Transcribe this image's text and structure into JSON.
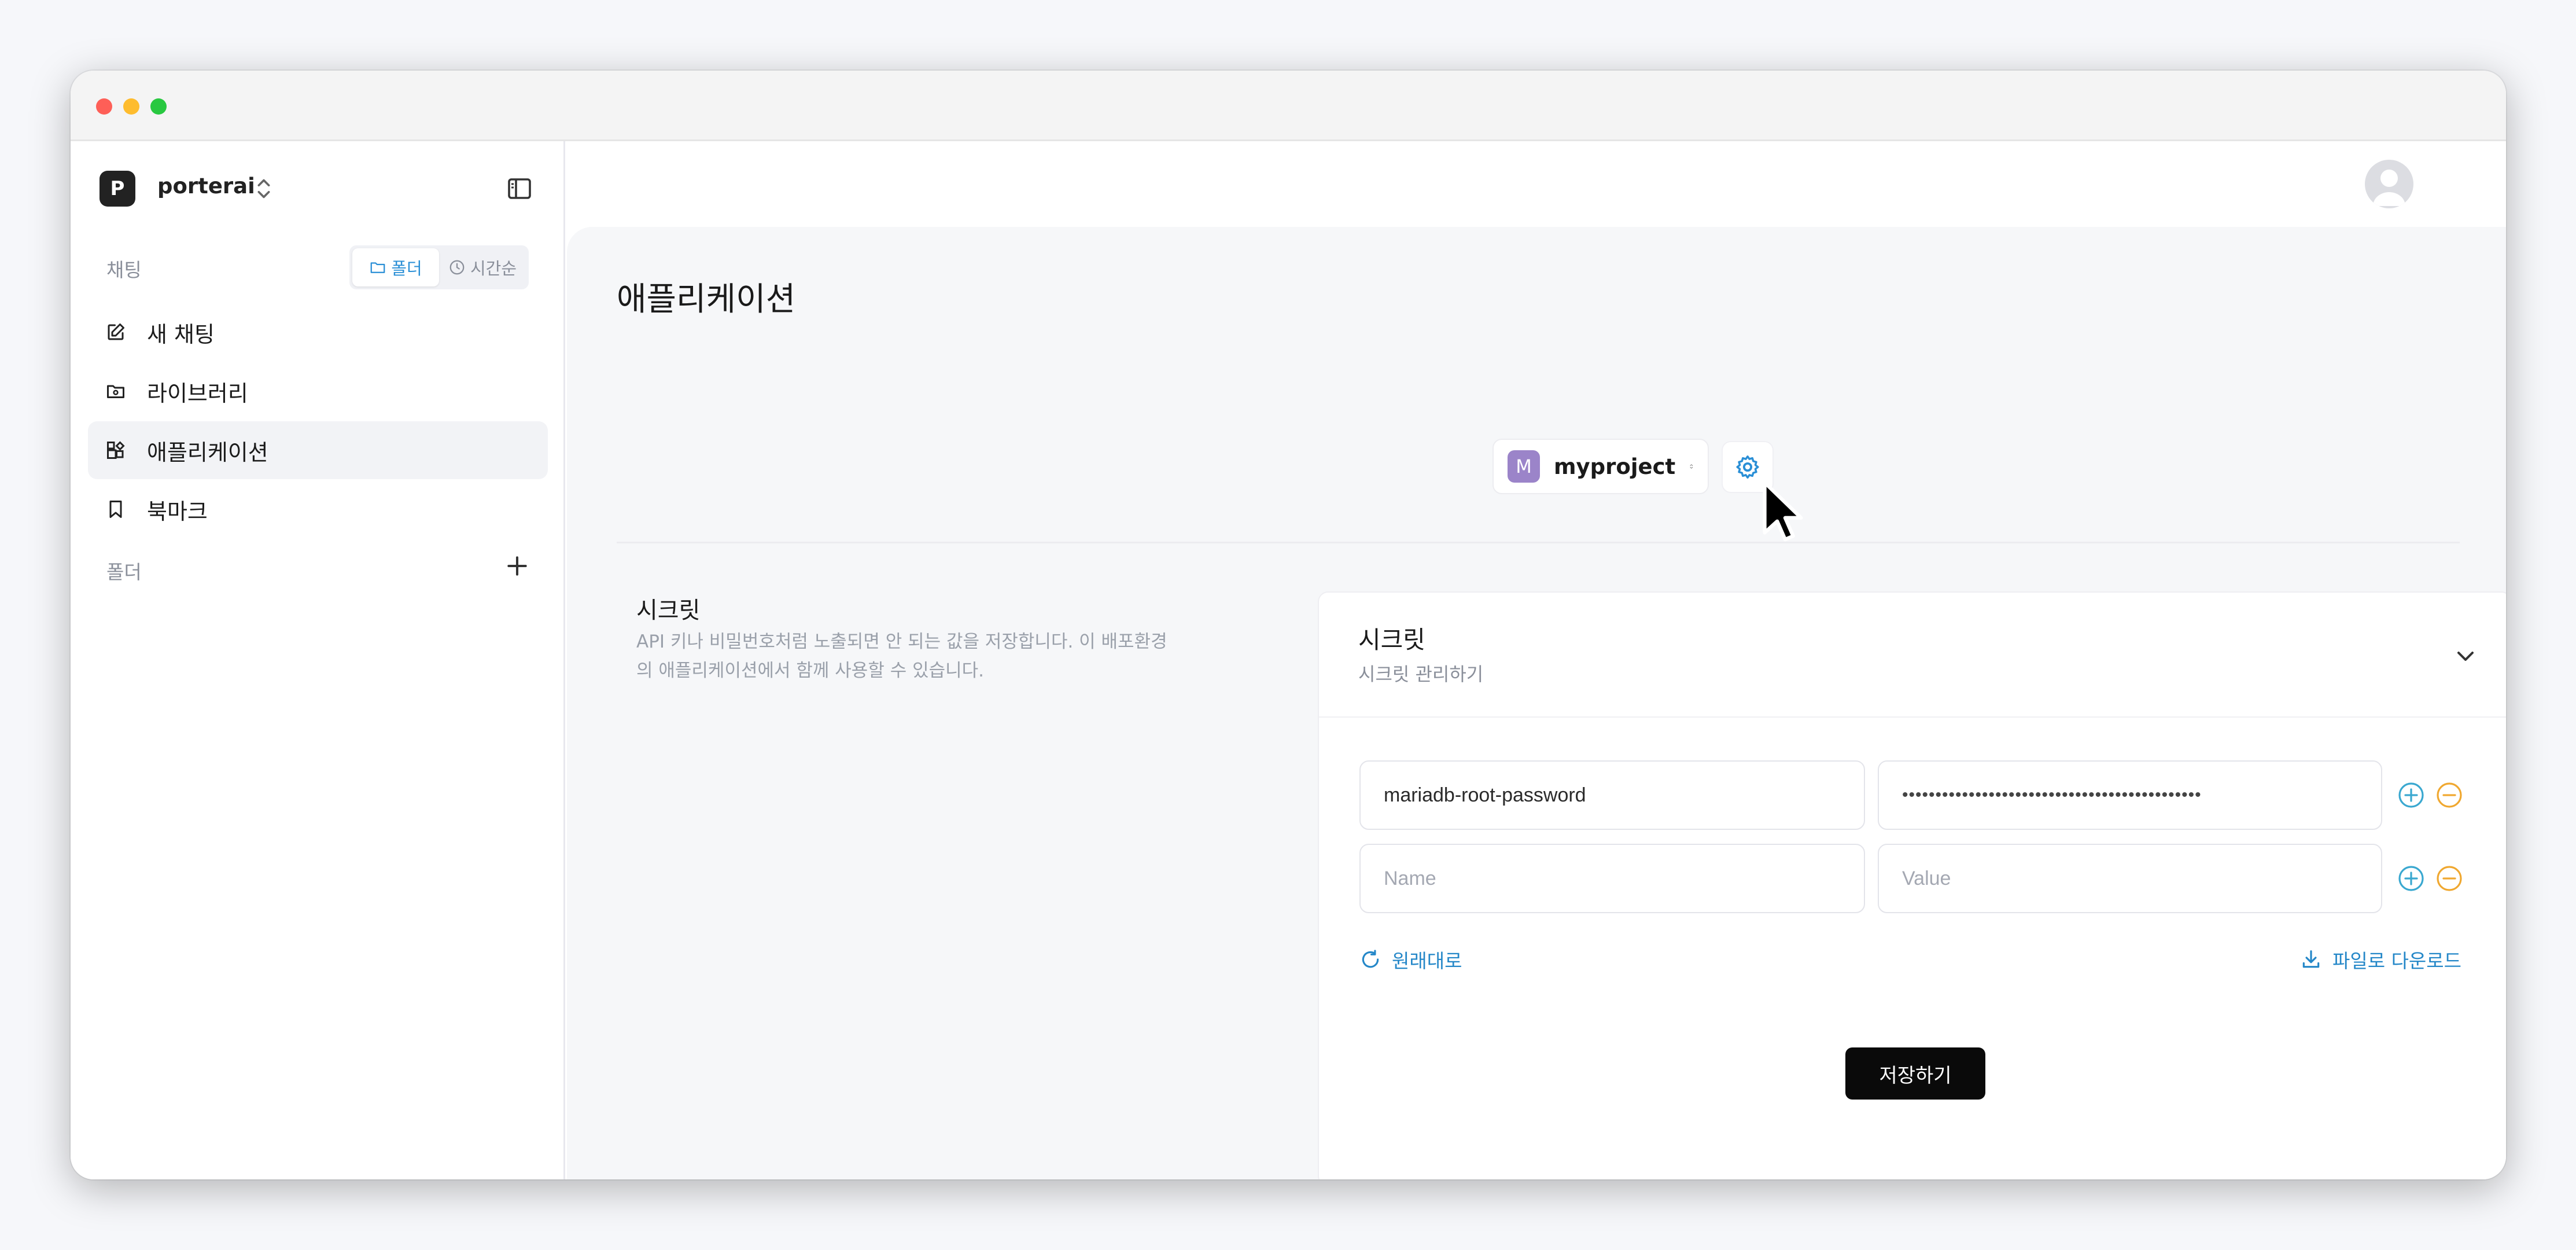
{
  "sidebar": {
    "workspace_initial": "P",
    "workspace_name": "porterai",
    "chat_section_label": "채팅",
    "view_toggle": {
      "folder": "폴더",
      "chronological": "시간순",
      "active": "folder"
    },
    "items": [
      {
        "label": "새 채팅",
        "icon": "edit-icon"
      },
      {
        "label": "라이브러리",
        "icon": "folder-icon"
      },
      {
        "label": "애플리케이션",
        "icon": "apps-icon",
        "active": true
      },
      {
        "label": "북마크",
        "icon": "bookmark-icon"
      }
    ],
    "folder_section_label": "폴더"
  },
  "main": {
    "title": "애플리케이션",
    "project": {
      "initial": "M",
      "name": "myproject",
      "badge_color": "#9b84c9"
    },
    "secrets_section": {
      "title": "시크릿",
      "description": "API 키나 비밀번호처럼 노출되면 안 되는 값을 저장합니다. 이 배포환경의 애플리케이션에서 함께 사용할 수 있습니다."
    },
    "secrets_card": {
      "title": "시크릿",
      "subtitle": "시크릿 관리하기",
      "rows": [
        {
          "name": "mariadb-root-password",
          "value": "•••••••••••••••••••••••••••••••••••••••••••••"
        },
        {
          "name_placeholder": "Name",
          "value_placeholder": "Value"
        }
      ],
      "reset_label": "원래대로",
      "download_label": "파일로 다운로드",
      "save_label": "저장하기"
    }
  },
  "colors": {
    "accent": "#2a8fd6",
    "add": "#3aa8d0",
    "remove": "#f0a830"
  }
}
